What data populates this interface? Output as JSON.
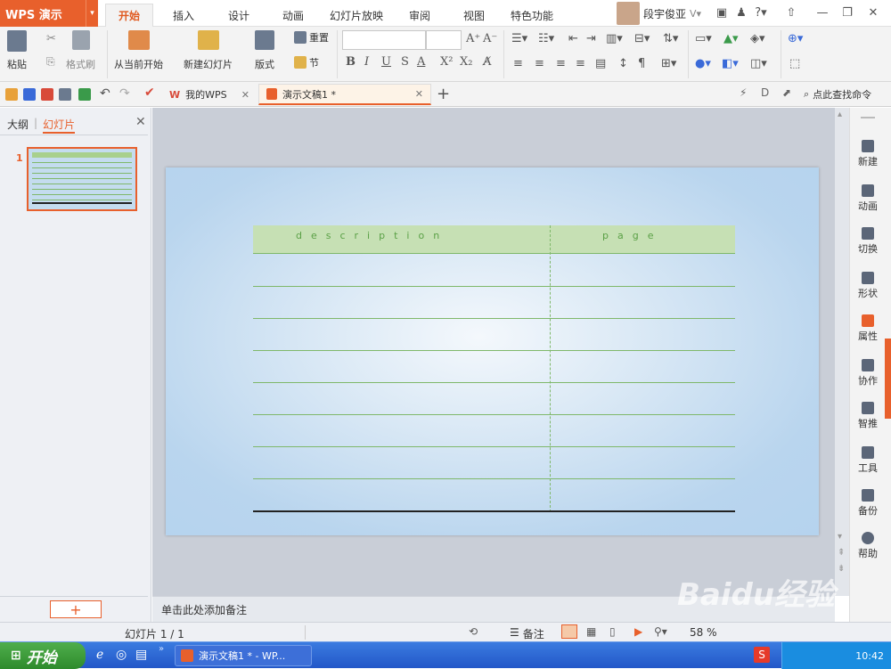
{
  "app": {
    "name": "WPS 演示",
    "user": "段宇俊亚"
  },
  "ribbon_tabs": [
    "开始",
    "插入",
    "设计",
    "动画",
    "幻灯片放映",
    "审阅",
    "视图",
    "特色功能"
  ],
  "ribbon": {
    "paste": "粘贴",
    "format_painter": "格式刷",
    "from_current": "从当前开始",
    "new_slide": "新建幻灯片",
    "layout": "版式",
    "reset": "重置",
    "section": "节"
  },
  "doc_tabs": {
    "my_wps": "我的WPS",
    "current": "演示文稿1 *"
  },
  "search_cmd": "点此查找命令",
  "left_panel": {
    "tab_outline": "大纲",
    "tab_slides": "幻灯片",
    "slide_number": "1",
    "add_slide": "+"
  },
  "table": {
    "header_description": "description",
    "header_page": "page"
  },
  "notes_placeholder": "单击此处添加备注",
  "right_sidebar": [
    "新建",
    "动画",
    "切换",
    "形状",
    "属性",
    "协作",
    "智推",
    "工具",
    "备份",
    "帮助"
  ],
  "status": {
    "slide_info": "幻灯片 1 / 1",
    "notes": "备注",
    "zoom": "58 %"
  },
  "taskbar": {
    "start": "开始",
    "task": "演示文稿1 * - WP...",
    "clock": "10:42"
  },
  "watermark": "Baidu经验",
  "colors": {
    "accent": "#e8602c",
    "table_header": "#c6e0b4",
    "table_line": "#7fb86a",
    "slide_bg": "#b9d5ee"
  }
}
